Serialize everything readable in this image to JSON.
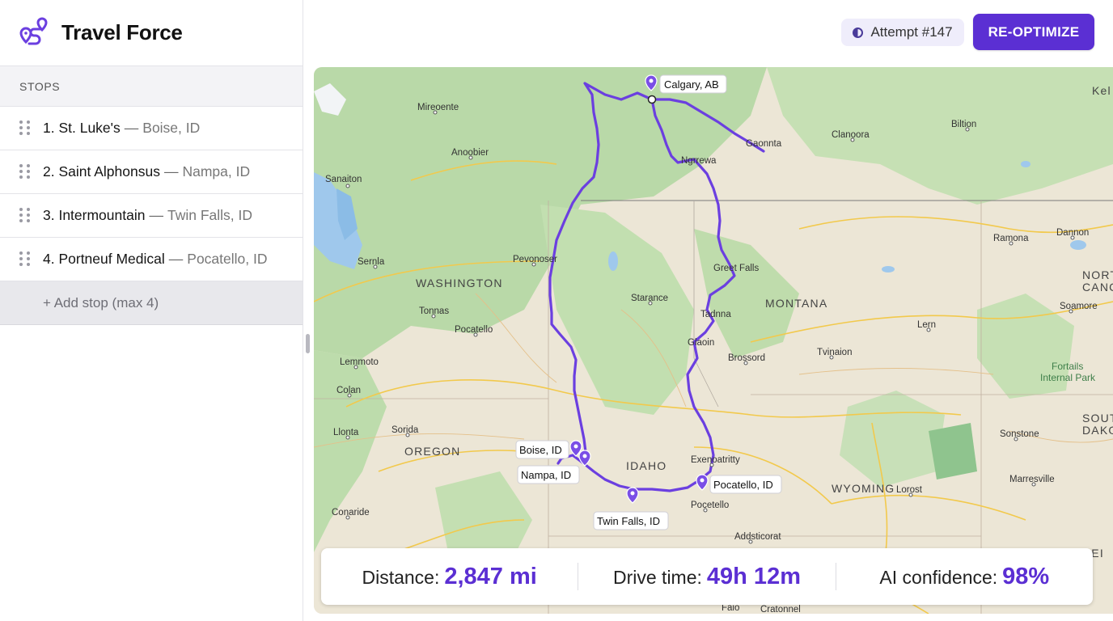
{
  "app": {
    "title": "Travel Force"
  },
  "sidebar": {
    "section_label": "STOPS",
    "stops": [
      {
        "name": "1. St. Luke's",
        "location": "Boise, ID"
      },
      {
        "name": "2. Saint Alphonsus",
        "location": "Nampa, ID"
      },
      {
        "name": "3. Intermountain",
        "location": "Twin Falls, ID"
      },
      {
        "name": "4. Portneuf Medical",
        "location": "Pocatello, ID"
      }
    ],
    "separator": "—",
    "add_stop_label": "+ Add stop (max 4)"
  },
  "header": {
    "attempt_label": "Attempt #147",
    "reoptimize_label": "RE-OPTIMIZE"
  },
  "map": {
    "route_color": "#6b3fe0",
    "pin_color": "#7a4fe6",
    "state_labels": [
      "WASHINGTON",
      "MONTANA",
      "OREGON",
      "IDAHO",
      "WYOMING"
    ],
    "edge_labels": [
      "NORT",
      "CANC",
      "SOUT",
      "DAKO",
      "NEI",
      "Kel"
    ],
    "park_label_1": "Fortails",
    "park_label_2": "Internal Park",
    "cities": [
      "Mireoente",
      "Anoobier",
      "Sanaiton",
      "Sernla",
      "Pevonoser",
      "Tonnas",
      "Pocatello",
      "Lemmoto",
      "Colan",
      "Llonta",
      "Sorida",
      "Conaride",
      "Starance",
      "Tadnna",
      "Glaoin",
      "Greet Falls",
      "Ngrrewa",
      "Gaonnta",
      "Clanoora",
      "Biltion",
      "Ramona",
      "Dannon",
      "Lern",
      "Soamore",
      "Brossord",
      "Tvinaion",
      "Exenoatritty",
      "Pocetello",
      "Sonstone",
      "Marresville",
      "Lorost",
      "Addsticorat",
      "Faio",
      "Cratonnel"
    ],
    "stop_labels": {
      "calgary": "Calgary, AB",
      "boise": "Boise, ID",
      "nampa": "Nampa, ID",
      "twin_falls": "Twin Falls, ID",
      "pocatello": "Pocatello, ID"
    }
  },
  "stats": {
    "distance_label": "Distance:",
    "distance_value": "2,847 mi",
    "drive_label": "Drive time:",
    "drive_value": "49h 12m",
    "confidence_label": "AI confidence:",
    "confidence_value": "98%"
  }
}
